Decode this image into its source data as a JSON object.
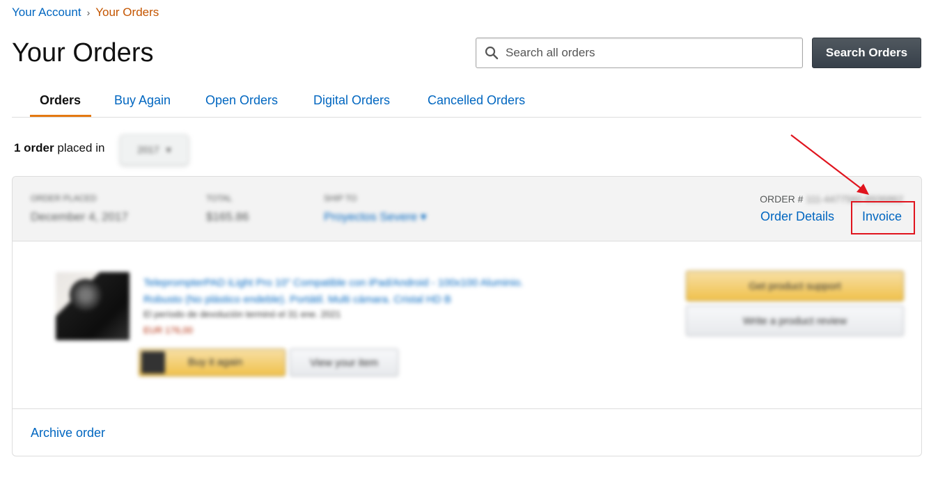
{
  "breadcrumb": {
    "account": "Your Account",
    "separator": "›",
    "current": "Your Orders"
  },
  "page_title": "Your Orders",
  "search": {
    "placeholder": "Search all orders",
    "button_label": "Search Orders"
  },
  "tabs": [
    {
      "label": "Orders",
      "active": true
    },
    {
      "label": "Buy Again",
      "active": false
    },
    {
      "label": "Open Orders",
      "active": false
    },
    {
      "label": "Digital Orders",
      "active": false
    },
    {
      "label": "Cancelled Orders",
      "active": false
    }
  ],
  "summary": {
    "count": "1 order",
    "text": "placed in",
    "year": "2017"
  },
  "order": {
    "placed_label": "ORDER PLACED",
    "placed_value": "December 4, 2017",
    "total_label": "TOTAL",
    "total_value": "$165.86",
    "ship_to_label": "SHIP TO",
    "ship_to_value": "Proyectos Severe",
    "order_number_label": "ORDER #",
    "order_number_value": "111-4477560-8936862",
    "order_details_link": "Order Details",
    "invoice_link": "Invoice",
    "product": {
      "title": "TeleprompterPAD iLight Pro 10\" Compatible con iPad/Android - 100x100 Aluminio. Robusto (No plástico endeble). Portátil. Multi cámara. Cristal HD B",
      "return_note": "El período de devolución terminó el 31 ene. 2021",
      "price": "EUR 176,00",
      "buy_again_label": "Buy it again",
      "view_item_label": "View your item"
    },
    "support_button": "Get product support",
    "review_button": "Write a product review",
    "archive_link": "Archive order"
  },
  "colors": {
    "link": "#0066c0",
    "active_tab_underline": "#e47911",
    "breadcrumb_current": "#c45500",
    "annotation": "#e0141e",
    "search_button": "#37404a"
  }
}
